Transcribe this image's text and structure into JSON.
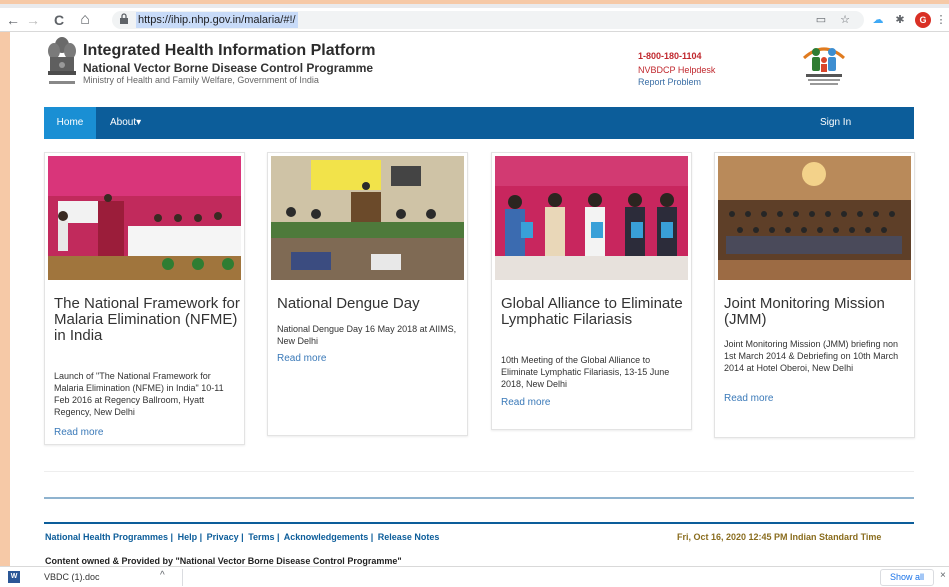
{
  "browser": {
    "url": "https://ihip.nhp.gov.in/malaria/#!/",
    "back_icon": "←",
    "forward_icon": "→",
    "reload_icon": "C",
    "home_icon": "⌂",
    "lock_icon": "🔒",
    "profile_initial": "G"
  },
  "header": {
    "title": "Integrated Health Information Platform",
    "subtitle": "National Vector Borne Disease Control Programme",
    "ministry": "Ministry of Health and Family Welfare, Government of India",
    "helpline": "1-800-180-1104",
    "helpdesk": "NVBDCP Helpdesk",
    "report": "Report Problem"
  },
  "nav": {
    "home": "Home",
    "about": "About▾",
    "signin": "Sign In"
  },
  "cards": [
    {
      "title": "The National Framework for Malaria Elimination (NFME) in India",
      "desc": "Launch of \"The National Framework for Malaria Elimination (NFME) in India\" 10-11 Feb 2016 at Regency Ballroom, Hyatt Regency, New Delhi",
      "more": "Read more"
    },
    {
      "title": "National Dengue Day",
      "desc": "National Dengue Day 16 May 2018 at AIIMS, New Delhi",
      "more": "Read more"
    },
    {
      "title": "Global Alliance to Eliminate Lymphatic Filariasis",
      "desc": "10th Meeting of the Global Alliance to Eliminate Lymphatic Filariasis, 13-15 June 2018, New Delhi",
      "more": "Read more"
    },
    {
      "title": "Joint Monitoring Mission (JMM)",
      "desc": "Joint Monitoring Mission (JMM) briefing non 1st March 2014 & Debriefing on 10th March 2014 at Hotel Oberoi, New Delhi",
      "more": "Read more"
    }
  ],
  "footer": {
    "links": [
      "National Health Programmes |",
      "Help |",
      "Privacy |",
      "Terms |",
      "Acknowledgements |",
      "Release Notes"
    ],
    "datetime": "Fri, Oct 16, 2020 12:45 PM Indian Standard Time",
    "owned": "Content owned & Provided by \"National Vector Borne Disease Control Programme\""
  },
  "downloads": {
    "file": "VBDC (1).doc",
    "show_all": "Show all",
    "chevron": "^",
    "close": "×"
  },
  "colors": {
    "navbar": "#0c5d9a",
    "nav_active": "#1a8fd4",
    "helpline": "#c0272d",
    "link": "#3a79b8"
  }
}
